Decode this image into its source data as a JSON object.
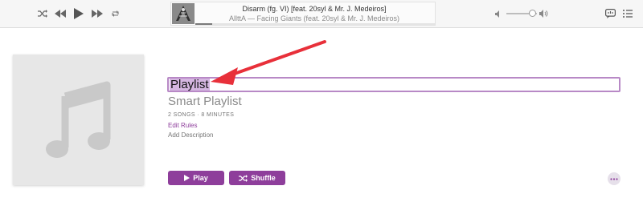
{
  "player": {
    "controls": [
      "shuffle-icon",
      "previous-icon",
      "play-icon",
      "next-icon",
      "repeat-icon"
    ],
    "now_playing": {
      "title": "Disarm (fg. VI) [feat. 20syl & Mr. J. Medeiros]",
      "subtitle": "AllttA — Facing Giants (feat. 20syl & Mr. J. Medeiros)",
      "progress": 0.07
    },
    "volume": 0.75,
    "right_icons": [
      "lyrics-icon",
      "up-next-icon"
    ]
  },
  "playlist": {
    "title": "Playlist",
    "type": "Smart Playlist",
    "meta": "2 SONGS · 8 MINUTES",
    "edit_rules": "Edit Rules",
    "add_description": "Add Description",
    "play_label": "Play",
    "shuffle_label": "Shuffle"
  },
  "colors": {
    "accent": "#8e3e9b",
    "selection": "#d5b6e1",
    "field_focus": "#b889c6",
    "annotation_arrow": "#e8303a"
  }
}
